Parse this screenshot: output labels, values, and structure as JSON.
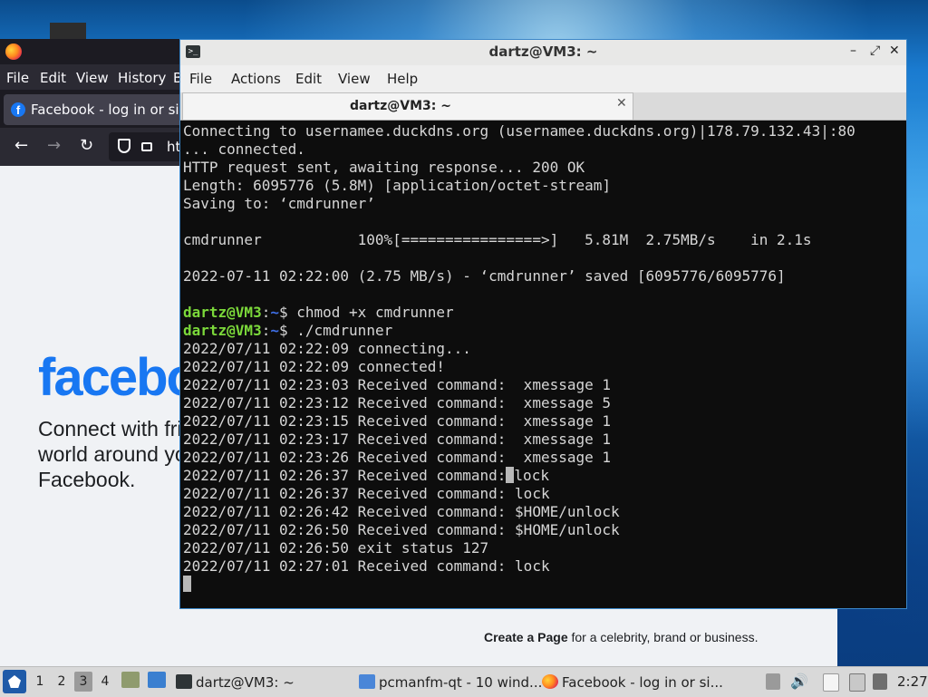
{
  "firefox": {
    "menu": [
      "File",
      "Edit",
      "View",
      "History",
      "B"
    ],
    "tab_title": "Facebook - log in or sign up",
    "url_partial": "ht",
    "facebook": {
      "logo": "facebook",
      "tagline": "Connect with friends and the world around you on Facebook.",
      "create_page_bold": "Create a Page",
      "create_page_rest": " for a celebrity, brand or business."
    }
  },
  "terminal": {
    "title": "dartz@VM3: ~",
    "menu": [
      "File",
      "Actions",
      "Edit",
      "View",
      "Help"
    ],
    "tab_title": "dartz@VM3: ~",
    "lines": [
      [
        {
          "t": "Connecting to usernamee.duckdns.org (usernamee.duckdns.org)|178.79.132.43|:80"
        }
      ],
      [
        {
          "t": "... connected."
        }
      ],
      [
        {
          "t": "HTTP request sent, awaiting response... 200 OK"
        }
      ],
      [
        {
          "t": "Length: 6095776 (5.8M) [application/octet-stream]"
        }
      ],
      [
        {
          "t": "Saving to: ‘cmdrunner’"
        }
      ],
      [
        {
          "t": ""
        }
      ],
      [
        {
          "t": "cmdrunner           100%[================>]   5.81M  2.75MB/s    in 2.1s"
        }
      ],
      [
        {
          "t": ""
        }
      ],
      [
        {
          "t": "2022-07-11 02:22:00 (2.75 MB/s) - ‘cmdrunner’ saved [6095776/6095776]"
        }
      ],
      [
        {
          "t": ""
        }
      ],
      [
        {
          "t": "dartz@VM3",
          "c": "prompt"
        },
        {
          "t": ":"
        },
        {
          "t": "~",
          "c": "path"
        },
        {
          "t": "$ chmod +x cmdrunner"
        }
      ],
      [
        {
          "t": "dartz@VM3",
          "c": "prompt"
        },
        {
          "t": ":"
        },
        {
          "t": "~",
          "c": "path"
        },
        {
          "t": "$ ./cmdrunner"
        }
      ],
      [
        {
          "t": "2022/07/11 02:22:09 connecting..."
        }
      ],
      [
        {
          "t": "2022/07/11 02:22:09 connected!"
        }
      ],
      [
        {
          "t": "2022/07/11 02:23:03 Received command:  xmessage 1"
        }
      ],
      [
        {
          "t": "2022/07/11 02:23:12 Received command:  xmessage 5"
        }
      ],
      [
        {
          "t": "2022/07/11 02:23:15 Received command:  xmessage 1"
        }
      ],
      [
        {
          "t": "2022/07/11 02:23:17 Received command:  xmessage 1"
        }
      ],
      [
        {
          "t": "2022/07/11 02:23:26 Received command:  xmessage 1"
        }
      ],
      [
        {
          "t": "2022/07/11 02:26:37 Received command:"
        },
        {
          "t": "",
          "c": "cursor"
        },
        {
          "t": "lock"
        }
      ],
      [
        {
          "t": "2022/07/11 02:26:37 Received command: lock"
        }
      ],
      [
        {
          "t": "2022/07/11 02:26:42 Received command: $HOME/unlock"
        }
      ],
      [
        {
          "t": "2022/07/11 02:26:50 Received command: $HOME/unlock"
        }
      ],
      [
        {
          "t": "2022/07/11 02:26:50 exit status 127"
        }
      ],
      [
        {
          "t": "2022/07/11 02:27:01 Received command: lock"
        }
      ],
      [
        {
          "t": "",
          "c": "cursor"
        }
      ]
    ]
  },
  "taskbar": {
    "workspaces": [
      "1",
      "2",
      "3",
      "4"
    ],
    "active_workspace": "3",
    "tasks": [
      {
        "label": "dartz@VM3: ~",
        "icon": "terminal-icon"
      },
      {
        "label": "pcmanfm-qt - 10 wind...",
        "icon": "folder-icon"
      },
      {
        "label": "Facebook - log in or si...",
        "icon": "firefox-icon"
      }
    ],
    "clock": "2:27"
  },
  "colors": {
    "prompt_user": "#7bd83a",
    "prompt_path": "#3e6fe6",
    "facebook_blue": "#1877f2",
    "terminal_bg": "#0d0d0d"
  }
}
